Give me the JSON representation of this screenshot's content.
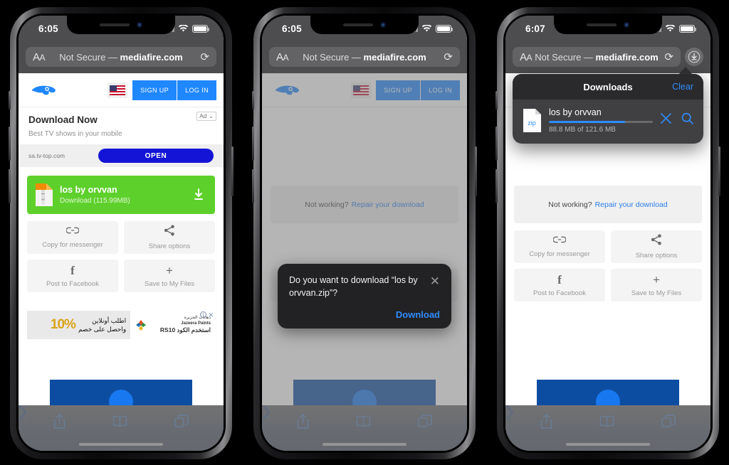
{
  "phones": [
    {
      "id": "phone-1",
      "status": {
        "time": "6:05",
        "signal_icon": "cellular-bars-icon",
        "wifi_icon": "wifi-icon",
        "battery_icon": "battery-icon"
      },
      "browser": {
        "aa_label": "AA",
        "url_prefix": "Not Secure — ",
        "url_domain": "mediafire.com",
        "reload_icon": "reload-icon",
        "has_download_chip": false
      },
      "site": {
        "logo_icon": "mediafire-logo-icon",
        "flag_icon": "us-flag-icon",
        "signup_label": "SIGN UP",
        "login_label": "LOG IN"
      },
      "ad": {
        "badge": "Ad",
        "title": "Download Now",
        "subtitle": "Best TV shows in your mobile",
        "domain": "sa.tv-top.com",
        "cta": "OPEN"
      },
      "download_button": {
        "file_name": "los by orvvan",
        "sub_label": "Download (115.99MB)",
        "download_icon": "download-arrow-icon",
        "color": "#5ed02b"
      },
      "tiles": [
        {
          "label": "Copy for messenger",
          "icon": "link-icon"
        },
        {
          "label": "Share options",
          "icon": "share-icon"
        },
        {
          "label": "Post to Facebook",
          "icon": "facebook-icon"
        },
        {
          "label": "Save to My Files",
          "icon": "plus-icon"
        }
      ],
      "banner_ad": {
        "percent": "10%",
        "arabic_line1": "اطلب أونلاين",
        "arabic_line2": "واحصل على خصم",
        "brand_ar": "دهانات الجزيرة",
        "brand_en": "Jazeera Paints",
        "code_text": "استخدم الكود RS10",
        "close_icon": "close-icon",
        "info_icon": "info-icon"
      },
      "toolbar": {
        "back_icon": "chevron-left-icon",
        "forward_icon": "chevron-right-icon",
        "share_icon": "share-box-icon",
        "bookmarks_icon": "book-icon",
        "tabs_icon": "tabs-icon"
      }
    },
    {
      "id": "phone-2",
      "status": {
        "time": "6:05"
      },
      "browser": {
        "aa_label": "AA",
        "url_prefix": "Not Secure — ",
        "url_domain": "mediafire.com",
        "has_download_chip": false
      },
      "site": {
        "signup_label": "SIGN UP",
        "login_label": "LOG IN"
      },
      "not_working": {
        "text": "Not working?",
        "link": "Repair your download"
      },
      "tiles": [
        {
          "label": "Post to Facebook",
          "icon": "facebook-icon"
        },
        {
          "label": "Save to My Files",
          "icon": "plus-icon"
        }
      ],
      "confirm_dialog": {
        "message": "Do you want to download “los by orvvan.zip”?",
        "close_icon": "close-icon",
        "action_label": "Download"
      }
    },
    {
      "id": "phone-3",
      "status": {
        "time": "6:07"
      },
      "browser": {
        "aa_label": "AA",
        "url_prefix": "Not Secure — ",
        "url_domain": "mediafire.com",
        "has_download_chip": true,
        "download_chip_icon": "download-circle-icon"
      },
      "not_working": {
        "text": "Not working?",
        "link": "Repair your download"
      },
      "tiles": [
        {
          "label": "Copy for messenger",
          "icon": "link-icon"
        },
        {
          "label": "Share options",
          "icon": "share-icon"
        },
        {
          "label": "Post to Facebook",
          "icon": "facebook-icon"
        },
        {
          "label": "Save to My Files",
          "icon": "plus-icon"
        }
      ],
      "downloads_popover": {
        "title": "Downloads",
        "clear_label": "Clear",
        "item": {
          "type_badge": "zip",
          "name": "los by orvvan",
          "progress_text": "88.8 MB of 121.6 MB",
          "progress_percent": 73,
          "stop_icon": "close-icon",
          "search_icon": "search-icon"
        }
      }
    }
  ],
  "colors": {
    "accent_blue": "#2f8cff",
    "brand_blue": "#1f87ff",
    "green": "#5ed02b",
    "ad_blue": "#1414d6"
  }
}
